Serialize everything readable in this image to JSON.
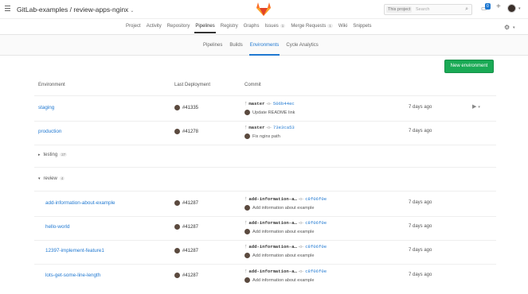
{
  "header": {
    "title": "GitLab-examples / review-apps-nginx",
    "search": {
      "scope": "This project",
      "placeholder": "Search"
    },
    "todo_count": "0"
  },
  "project_nav": [
    {
      "label": "Project"
    },
    {
      "label": "Activity"
    },
    {
      "label": "Repository"
    },
    {
      "label": "Pipelines",
      "active": true
    },
    {
      "label": "Registry"
    },
    {
      "label": "Graphs"
    },
    {
      "label": "Issues",
      "count": "1"
    },
    {
      "label": "Merge Requests",
      "count": "1"
    },
    {
      "label": "Wiki"
    },
    {
      "label": "Snippets"
    }
  ],
  "sub_nav": [
    {
      "label": "Pipelines"
    },
    {
      "label": "Builds"
    },
    {
      "label": "Environments",
      "active": true
    },
    {
      "label": "Cycle Analytics"
    }
  ],
  "new_env_button": "New environment",
  "table": {
    "headers": {
      "environment": "Environment",
      "last_deployment": "Last Deployment",
      "commit": "Commit"
    },
    "rows": [
      {
        "name": "staging",
        "deployment": "#41335",
        "branch": "master",
        "sha": "506b44ec",
        "message": "Update README link",
        "ago": "7 days ago"
      },
      {
        "name": "production",
        "deployment": "#41278",
        "branch": "master",
        "sha": "73e3ca53",
        "message": "Fix nginx path",
        "ago": "7 days ago"
      }
    ],
    "folders": [
      {
        "name": "testing",
        "count": "27"
      },
      {
        "name": "review",
        "count": "4"
      }
    ],
    "review_rows": [
      {
        "name": "add-information-about-example",
        "deployment": "#41287",
        "branch": "add-information-a…",
        "sha": "c8f06f0e",
        "message": "Add information about example",
        "ago": "7 days ago"
      },
      {
        "name": "hello-world",
        "deployment": "#41287",
        "branch": "add-information-a…",
        "sha": "c8f06f0e",
        "message": "Add information about example",
        "ago": "7 days ago"
      },
      {
        "name": "12397-implement-feature1",
        "deployment": "#41287",
        "branch": "add-information-a…",
        "sha": "c8f06f0e",
        "message": "Add information about example",
        "ago": "7 days ago"
      },
      {
        "name": "lots-get-some-line-length",
        "deployment": "#41287",
        "branch": "add-information-a…",
        "sha": "c8f06f0e",
        "message": "Add information about example",
        "ago": "7 days ago"
      }
    ]
  },
  "colors": {
    "link": "#1f78d1",
    "button_green": "#1aaa55",
    "logo_orange": "#e24329"
  }
}
